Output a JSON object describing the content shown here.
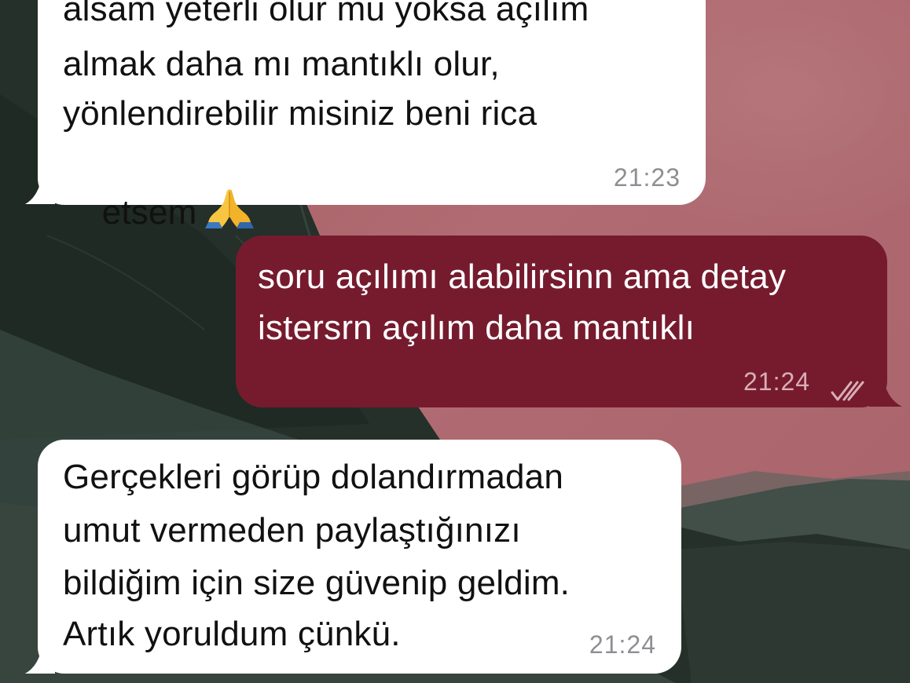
{
  "messages": [
    {
      "direction": "incoming",
      "lines": [
        "alsam yeterli olur mu yoksa açılım",
        "almak daha mı mantıklı olur,",
        "yönlendirebilir misiniz beni rica",
        "etsem"
      ],
      "emoji": "folded-hands-emoji",
      "time": "21:23"
    },
    {
      "direction": "outgoing",
      "lines": [
        "soru açılımı alabilirsinn ama detay",
        "istersrn açılım daha mantıklı"
      ],
      "time": "21:24",
      "status_icon": "double-check-read-icon"
    },
    {
      "direction": "incoming",
      "lines": [
        "Gerçekleri görüp dolandırmadan",
        "umut vermeden paylaştığınızı",
        "bildiğim için size güvenip geldim.",
        "Artık yoruldum çünkü."
      ],
      "time": "21:24"
    }
  ],
  "colors": {
    "incoming_bubble": "#ffffff",
    "outgoing_bubble": "#761b2e",
    "wallpaper_pink": "#a86268",
    "wallpaper_dark": "#2a3430"
  }
}
